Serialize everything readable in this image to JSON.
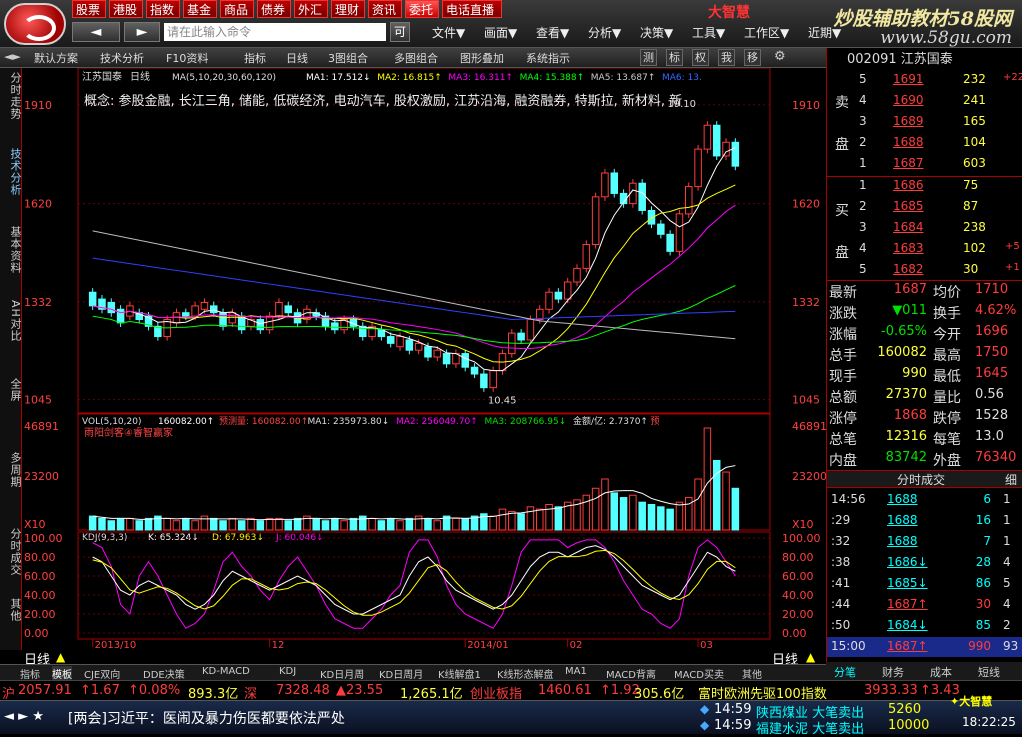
{
  "menu_tabs": [
    "股票",
    "港股",
    "指数",
    "基金",
    "商品",
    "债券",
    "外汇",
    "理财",
    "资讯",
    "委托",
    "电话直播"
  ],
  "active_tab_index": 9,
  "nav": {
    "back": "◄",
    "forward": "►",
    "command_placeholder": "请在此输入命令",
    "cmd_btn": "可"
  },
  "menus": [
    "文件▼",
    "画面▼",
    "查看▼",
    "分析▼",
    "决策▼",
    "工具▼",
    "工作区▼",
    "近期▼"
  ],
  "ad": {
    "red": "大智慧",
    "title": "炒股辅助教材58股网",
    "url": "www.58gu.com"
  },
  "toolbar": [
    "默认方案",
    "技术分析",
    "F10资料",
    "指标",
    "日线",
    "3图组合",
    "多图组合",
    "图形叠加",
    "系统指示"
  ],
  "toolbar_btns": [
    "测",
    "标",
    "权",
    "我",
    "移"
  ],
  "left_tabs": [
    "分时走势",
    "技术分析",
    "基本资料",
    "AH对比",
    "全屏",
    "多周期",
    "分时成交",
    "其他"
  ],
  "chart": {
    "stock_name": "江苏国泰",
    "period": "日线",
    "ma_header": "MA(5,10,20,30,60,120)",
    "ma_values": [
      "MA1: 17.512↓",
      "MA2: 16.815↑",
      "MA3: 16.311↑",
      "MA4: 15.388↑",
      "MA5: 13.687↑",
      "MA6: 13."
    ],
    "concept": "概念: 参股金融, 长江三角, 储能, 低碳经济, 电动汽车, 股权激励, 江苏沿海, 融资融券, 特斯拉, 新材料, 新",
    "price_ticks": [
      "1910",
      "1620",
      "1332",
      "1045"
    ],
    "high_label": "19.10",
    "low_label": "10.45",
    "vol_header": "VOL(5,10,20)",
    "vol_values": [
      "160082.00↑",
      "预测量: 160082.00↑",
      "MA1: 235973.80↓",
      "MA2: 256049.70↑",
      "MA3: 208766.95↓",
      "金额/亿: 2.7370↑",
      "预"
    ],
    "vol_sub": "雨阳剑客④睿智赢家",
    "vol_ticks": [
      "46891",
      "23200",
      "X10"
    ],
    "kdj_header": "KDJ(9,3,3)",
    "kdj_values": [
      "K: 65.324↓",
      "D: 67.963↓",
      "J: 60.046↓"
    ],
    "kdj_ticks": [
      "100.00",
      "80.00",
      "60.00",
      "40.00",
      "20.00",
      "0.00"
    ],
    "x_labels": [
      "2013/10",
      "12",
      "2014/01",
      "02",
      "03"
    ],
    "period_label": "日线"
  },
  "chart_data": {
    "type": "candlestick",
    "y_range": [
      10.45,
      19.1
    ],
    "candles": [
      [
        13.6,
        13.2
      ],
      [
        13.4,
        13.1
      ],
      [
        13.3,
        13.0
      ],
      [
        13.1,
        12.7
      ],
      [
        12.9,
        13.2
      ],
      [
        13.0,
        12.8
      ],
      [
        12.9,
        12.6
      ],
      [
        12.6,
        12.3
      ],
      [
        12.3,
        12.8
      ],
      [
        12.7,
        13.0
      ],
      [
        13.0,
        12.9
      ],
      [
        12.9,
        13.2
      ],
      [
        13.1,
        13.3
      ],
      [
        13.2,
        13.0
      ],
      [
        13.0,
        12.6
      ],
      [
        12.7,
        13.0
      ],
      [
        12.9,
        12.5
      ],
      [
        12.6,
        12.8
      ],
      [
        12.8,
        12.5
      ],
      [
        12.5,
        12.9
      ],
      [
        12.9,
        13.3
      ],
      [
        13.2,
        13.0
      ],
      [
        13.0,
        12.7
      ],
      [
        12.8,
        13.1
      ],
      [
        13.0,
        12.9
      ],
      [
        12.9,
        12.6
      ],
      [
        12.7,
        12.5
      ],
      [
        12.5,
        12.8
      ],
      [
        12.8,
        12.6
      ],
      [
        12.6,
        12.3
      ],
      [
        12.3,
        12.6
      ],
      [
        12.5,
        12.3
      ],
      [
        12.3,
        12.1
      ],
      [
        12.0,
        12.3
      ],
      [
        12.2,
        11.9
      ],
      [
        11.9,
        12.1
      ],
      [
        12.0,
        11.7
      ],
      [
        11.7,
        11.9
      ],
      [
        11.8,
        11.5
      ],
      [
        11.5,
        11.8
      ],
      [
        11.8,
        11.4
      ],
      [
        11.4,
        11.2
      ],
      [
        11.2,
        10.8
      ],
      [
        10.8,
        11.3
      ],
      [
        11.3,
        11.8
      ],
      [
        11.8,
        12.4
      ],
      [
        12.4,
        12.2
      ],
      [
        12.2,
        12.8
      ],
      [
        12.8,
        13.1
      ],
      [
        13.1,
        13.6
      ],
      [
        13.6,
        13.4
      ],
      [
        13.4,
        13.9
      ],
      [
        13.9,
        14.3
      ],
      [
        14.3,
        15.0
      ],
      [
        15.0,
        16.4
      ],
      [
        16.4,
        17.1
      ],
      [
        17.1,
        16.5
      ],
      [
        16.5,
        16.2
      ],
      [
        16.2,
        16.8
      ],
      [
        16.8,
        16.0
      ],
      [
        16.0,
        15.6
      ],
      [
        15.6,
        15.3
      ],
      [
        15.3,
        14.8
      ],
      [
        14.8,
        15.9
      ],
      [
        15.9,
        16.7
      ],
      [
        16.7,
        17.8
      ],
      [
        17.8,
        18.5
      ],
      [
        18.5,
        17.6
      ],
      [
        17.6,
        18.0
      ],
      [
        18.0,
        17.3
      ]
    ],
    "volumes": [
      6,
      5,
      4,
      5,
      5,
      4,
      5,
      6,
      5,
      4,
      5,
      4,
      6,
      5,
      4,
      5,
      4,
      5,
      4,
      5,
      5,
      4,
      5,
      6,
      5,
      4,
      5,
      4,
      5,
      6,
      5,
      4,
      5,
      4,
      5,
      6,
      5,
      4,
      6,
      5,
      5,
      6,
      7,
      6,
      9,
      8,
      7,
      10,
      9,
      11,
      10,
      12,
      13,
      15,
      18,
      22,
      16,
      14,
      15,
      12,
      11,
      10,
      9,
      12,
      14,
      22,
      44,
      30,
      25,
      18
    ],
    "kdj_k": [
      80,
      75,
      60,
      45,
      40,
      50,
      55,
      50,
      45,
      40,
      30,
      25,
      30,
      40,
      55,
      65,
      60,
      55,
      50,
      45,
      50,
      55,
      60,
      55,
      50,
      40,
      30,
      25,
      20,
      20,
      25,
      30,
      35,
      40,
      60,
      75,
      80,
      70,
      55,
      45,
      40,
      35,
      30,
      25,
      30,
      40,
      55,
      70,
      80,
      85,
      85,
      80,
      85,
      90,
      92,
      88,
      80,
      70,
      60,
      50,
      45,
      40,
      35,
      40,
      55,
      70,
      85,
      80,
      70,
      65
    ],
    "kdj_j": [
      95,
      90,
      70,
      30,
      20,
      60,
      75,
      60,
      40,
      20,
      5,
      10,
      20,
      45,
      75,
      85,
      70,
      60,
      45,
      35,
      55,
      70,
      80,
      65,
      50,
      30,
      15,
      10,
      5,
      5,
      15,
      25,
      40,
      50,
      85,
      98,
      98,
      80,
      50,
      30,
      20,
      15,
      10,
      5,
      20,
      50,
      85,
      98,
      98,
      98,
      98,
      90,
      95,
      98,
      98,
      90,
      75,
      55,
      40,
      25,
      20,
      10,
      5,
      15,
      60,
      90,
      98,
      90,
      75,
      60
    ]
  },
  "quote": {
    "code_name": "002091 江苏国泰",
    "sell": [
      {
        "lv": "5",
        "price": "1691",
        "vol": "232",
        "chg": "+22"
      },
      {
        "lv": "4",
        "price": "1690",
        "vol": "241",
        "chg": ""
      },
      {
        "lv": "3",
        "price": "1689",
        "vol": "165",
        "chg": ""
      },
      {
        "lv": "2",
        "price": "1688",
        "vol": "104",
        "chg": ""
      },
      {
        "lv": "1",
        "price": "1687",
        "vol": "603",
        "chg": ""
      }
    ],
    "buy": [
      {
        "lv": "1",
        "price": "1686",
        "vol": "75",
        "chg": ""
      },
      {
        "lv": "2",
        "price": "1685",
        "vol": "87",
        "chg": ""
      },
      {
        "lv": "3",
        "price": "1684",
        "vol": "238",
        "chg": ""
      },
      {
        "lv": "4",
        "price": "1683",
        "vol": "102",
        "chg": "+5"
      },
      {
        "lv": "5",
        "price": "1682",
        "vol": "30",
        "chg": "+1"
      }
    ],
    "sell_label": [
      "卖",
      "盘"
    ],
    "buy_label": [
      "买",
      "盘"
    ],
    "stats": [
      {
        "l": "最新",
        "v": "1687",
        "l2": "均价",
        "v2": "1710"
      },
      {
        "l": "涨跌",
        "v": "▼011",
        "l2": "换手",
        "v2": "4.62%"
      },
      {
        "l": "涨幅",
        "v": "-0.65%",
        "l2": "今开",
        "v2": "1696"
      },
      {
        "l": "总手",
        "v": "160082",
        "l2": "最高",
        "v2": "1750"
      },
      {
        "l": "现手",
        "v": "990",
        "l2": "最低",
        "v2": "1645"
      },
      {
        "l": "总额",
        "v": "27370",
        "l2": "量比",
        "v2": "0.56"
      },
      {
        "l": "涨停",
        "v": "1868",
        "l2": "跌停",
        "v2": "1528"
      },
      {
        "l": "总笔",
        "v": "12316",
        "l2": "每笔",
        "v2": "13.0"
      },
      {
        "l": "内盘",
        "v": "83742",
        "l2": "外盘",
        "v2": "76340"
      }
    ],
    "ticks_title": "分时成交",
    "ticks_sub": "细",
    "ticks": [
      {
        "t": "14:56",
        "p": "1688",
        "a": "",
        "v": "6",
        "n": "1"
      },
      {
        "t": ":29",
        "p": "1688",
        "a": "",
        "v": "16",
        "n": "1"
      },
      {
        "t": ":32",
        "p": "1688",
        "a": "",
        "v": "7",
        "n": "1"
      },
      {
        "t": ":38",
        "p": "1686",
        "a": "↓",
        "v": "28",
        "n": "4"
      },
      {
        "t": ":41",
        "p": "1685",
        "a": "↓",
        "v": "86",
        "n": "5"
      },
      {
        "t": ":44",
        "p": "1687",
        "a": "↑",
        "v": "30",
        "n": "4"
      },
      {
        "t": ":50",
        "p": "1684",
        "a": "↓",
        "v": "85",
        "n": "2"
      },
      {
        "t": "15:00",
        "p": "1687",
        "a": "↑",
        "v": "990",
        "n": "93"
      }
    ],
    "tabs": [
      "分笔",
      "财务",
      "成本",
      "短线"
    ]
  },
  "bottom_tabs": [
    "指标",
    "模板",
    "CJE双向",
    "DDE决策",
    "KD-MACD",
    "KDJ",
    "KD日月周",
    "KD日周月",
    "K线解盘1",
    "K线形态解盘",
    "MA1",
    "MACD背离",
    "MACD买卖",
    "其他"
  ],
  "ticker": [
    {
      "label": "沪",
      "v": "2057.91",
      "c": "↑1.67",
      "p": "↑0.08%",
      "a": "893.3亿"
    },
    {
      "label": "深",
      "v": "7328.48",
      "c": "▲23.55",
      "p": "1,265.1亿"
    },
    {
      "label": "创业板指",
      "v": "1460.61",
      "c": "↑1.92",
      "a": "305.6亿"
    }
  ],
  "ticker_right": {
    "label": "富时欧洲先驱100指数",
    "v": "3933.33",
    "c": "↑3.43"
  },
  "news": "[两会]习近平：医闹及暴力伤医都要依法严处",
  "alerts": [
    {
      "t": "14:59",
      "text": "陕西煤业 大笔卖出",
      "v": "5260"
    },
    {
      "t": "14:59",
      "text": "福建水泥 大笔卖出",
      "v": "10000"
    }
  ],
  "clock": "18:22:25",
  "dzh_logo": "大智慧"
}
